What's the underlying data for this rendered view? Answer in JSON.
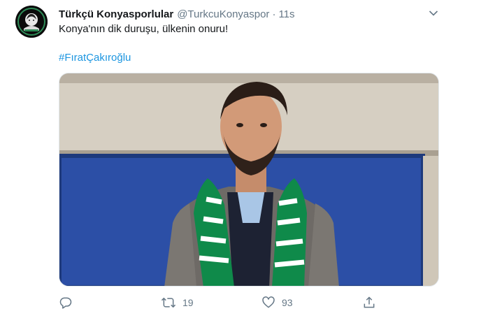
{
  "tweet": {
    "display_name": "Türkçü Konyasporlular",
    "handle": "@TurkcuKonyaspor",
    "separator": "·",
    "time": "11s",
    "text": "Konya'nın dik duruşu, ülkenin onuru!",
    "hashtag": "#FıratÇakıroğlu",
    "avatar_icon": "club-logo-icon",
    "media": {
      "description_icon": "photo",
      "scarf_colors": [
        "#0f8a4a",
        "#ffffff"
      ]
    },
    "actions": {
      "reply": {
        "icon": "reply-icon",
        "count": ""
      },
      "retweet": {
        "icon": "retweet-icon",
        "count": "19"
      },
      "like": {
        "icon": "heart-icon",
        "count": "93"
      },
      "share": {
        "icon": "share-icon",
        "count": ""
      }
    }
  },
  "colors": {
    "link": "#1b95e0",
    "muted": "#657786",
    "text": "#14171a"
  }
}
